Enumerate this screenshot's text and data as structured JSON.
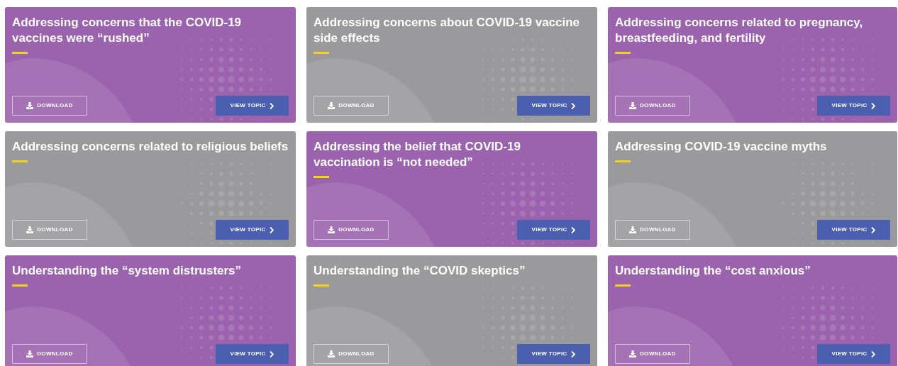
{
  "cards": [
    {
      "title": "Addressing concerns that the COVID-19 vaccines were “rushed”",
      "color": "#9b63ad",
      "download": "DOWNLOAD",
      "view": "VIEW TOPIC"
    },
    {
      "title": "Addressing concerns about COVID-19 vaccine side effects",
      "color": "#9a999b",
      "download": "DOWNLOAD",
      "view": "VIEW TOPIC"
    },
    {
      "title": "Addressing concerns related to pregnancy, breastfeeding, and fertility",
      "color": "#9b63ad",
      "download": "DOWNLOAD",
      "view": "VIEW TOPIC"
    },
    {
      "title": "Addressing concerns related to religious beliefs",
      "color": "#9a999b",
      "download": "DOWNLOAD",
      "view": "VIEW TOPIC"
    },
    {
      "title": "Addressing the belief that COVID-19 vaccination is “not needed”",
      "color": "#9b63ad",
      "download": "DOWNLOAD",
      "view": "VIEW TOPIC"
    },
    {
      "title": "Addressing COVID-19 vaccine myths",
      "color": "#9a999b",
      "download": "DOWNLOAD",
      "view": "VIEW TOPIC"
    },
    {
      "title": "Understanding the “system distrusters”",
      "color": "#9b63ad",
      "download": "DOWNLOAD",
      "view": "VIEW TOPIC"
    },
    {
      "title": "Understanding the “COVID skeptics”",
      "color": "#9a999b",
      "download": "DOWNLOAD",
      "view": "VIEW TOPIC"
    },
    {
      "title": "Understanding the “cost anxious”",
      "color": "#9b63ad",
      "download": "DOWNLOAD",
      "view": "VIEW TOPIC"
    }
  ]
}
